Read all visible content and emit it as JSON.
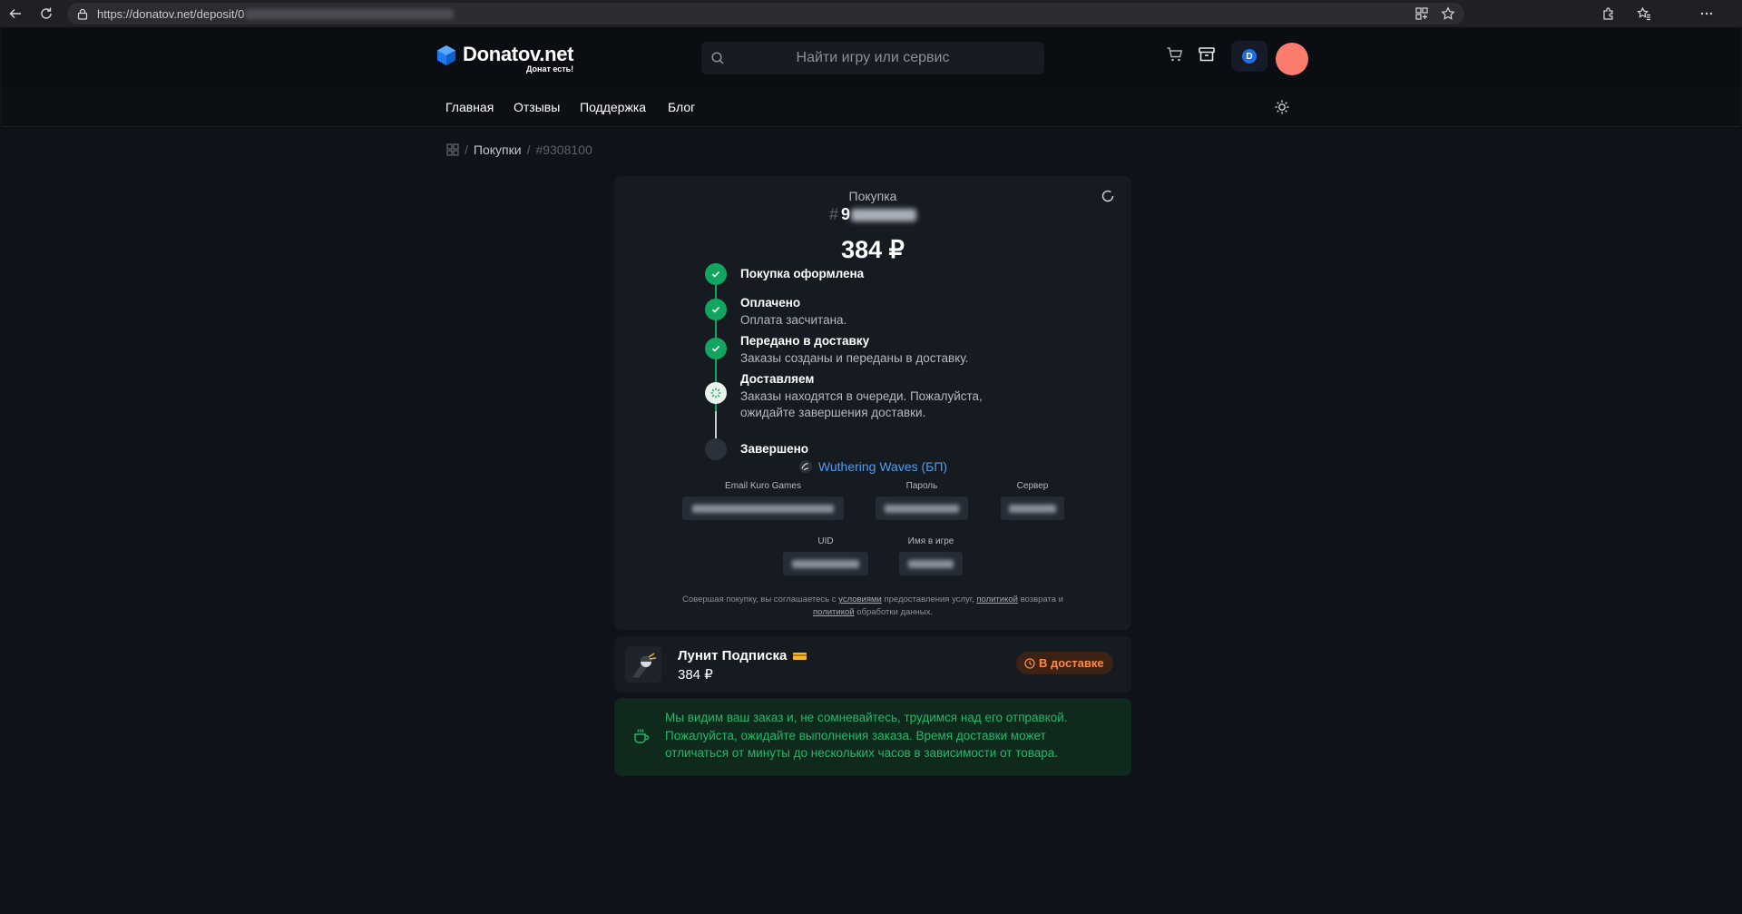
{
  "browser": {
    "url_visible": "https://donatov.net/deposit/0"
  },
  "header": {
    "logo_name": "Donatov.net",
    "logo_tagline": "Донат есть!",
    "search_placeholder": "Найти игру или сервис",
    "coin_badge": "D"
  },
  "nav": {
    "items": [
      "Главная",
      "Отзывы",
      "Поддержка",
      "Блог"
    ]
  },
  "breadcrumb": {
    "section": "Покупки",
    "current": "#9308100"
  },
  "order": {
    "label": "Покупка",
    "hash": "#",
    "id_prefix": "9",
    "total": "384 ₽",
    "steps": [
      {
        "title": "Покупка оформлена",
        "description": "",
        "state": "done"
      },
      {
        "title": "Оплачено",
        "description": "Оплата засчитана.",
        "state": "done"
      },
      {
        "title": "Передано в доставку",
        "description": "Заказы созданы и переданы в доставку.",
        "state": "done"
      },
      {
        "title": "Доставляем",
        "description": "Заказы находятся в очереди. Пожалуйста, ожидайте завершения доставки.",
        "state": "active"
      },
      {
        "title": "Завершено",
        "description": "",
        "state": "pending"
      }
    ],
    "game": {
      "name": "Wuthering Waves (БП)",
      "fields": [
        {
          "label": "Email Kuro Games"
        },
        {
          "label": "Пароль"
        },
        {
          "label": "Сервер"
        },
        {
          "label": "UID"
        },
        {
          "label": "Имя в игре"
        }
      ]
    },
    "disclaimer": {
      "part1": "Совершая покупку, вы соглашаетесь с ",
      "link1": "условиями",
      "part2": " предоставления услуг, ",
      "link2": "политикой",
      "part3": " возврата и ",
      "link3": "политикой",
      "part4": " обработки данных."
    }
  },
  "product": {
    "name": "Лунит Подписка",
    "price": "384 ₽",
    "status": "В доставке"
  },
  "notice": {
    "text": "Мы видим ваш заказ и, не сомневайтесь, трудимся над его отправкой. Пожалуйста, ожидайте выполнения заказа. Время доставки может отличаться от минуты до нескольких часов в зависимости от товара."
  },
  "colors": {
    "accent_green": "#13a55f",
    "link_blue": "#4f9cf0",
    "status_orange": "#ff8a3d",
    "avatar": "#fa7c6c"
  }
}
